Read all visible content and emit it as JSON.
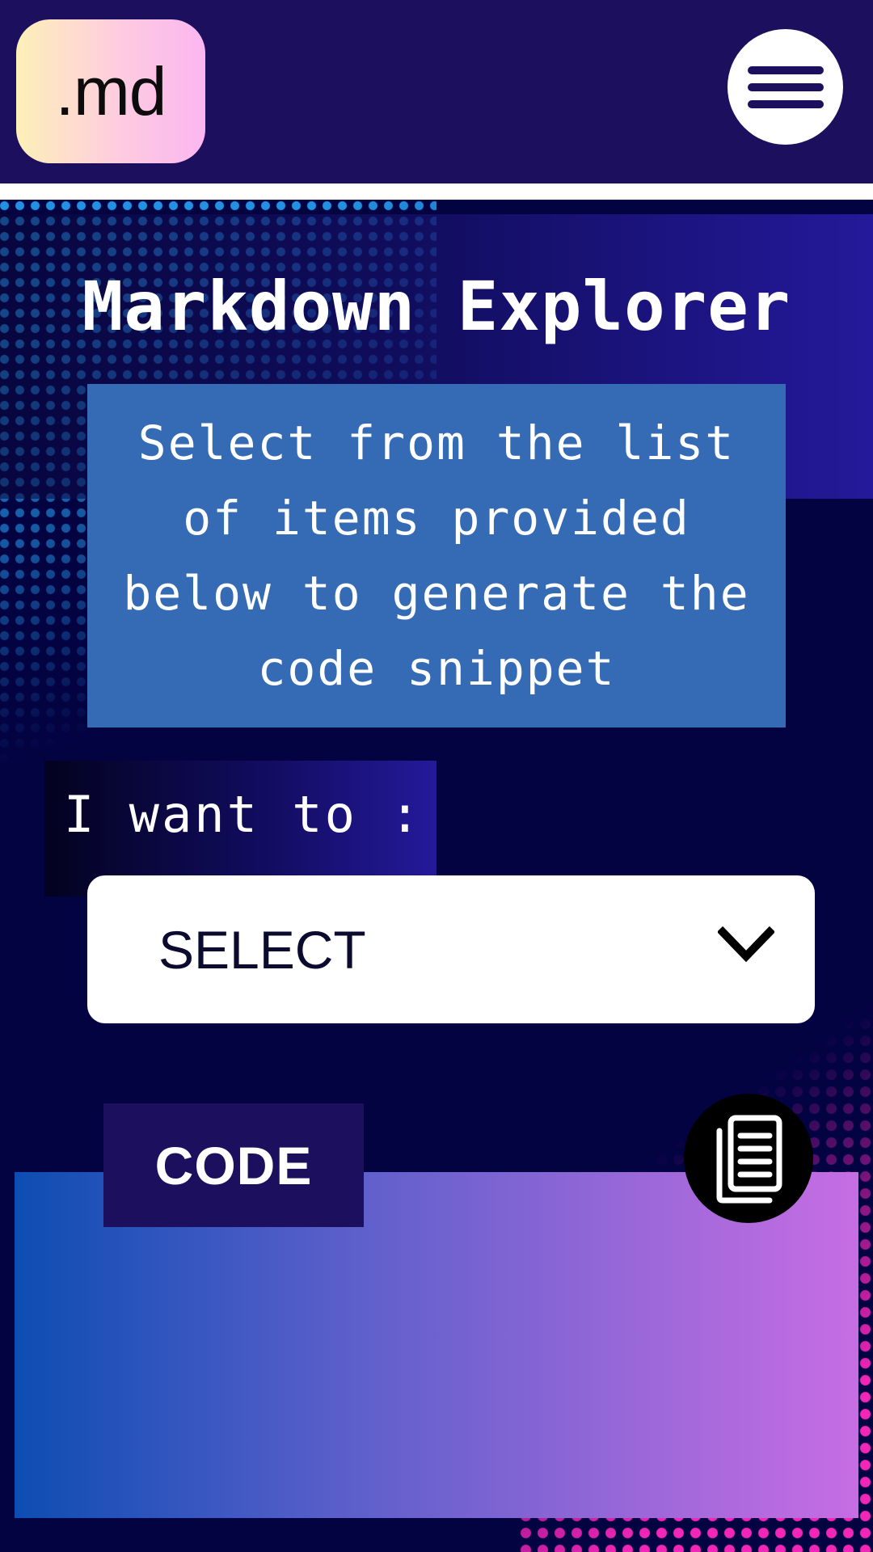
{
  "header": {
    "logo_text": ".md",
    "menu_icon": "hamburger-menu-icon"
  },
  "main": {
    "title": "Markdown Explorer",
    "intro_text": "Select from the list of items provided below to generate the code snippet",
    "want_label": "I want to :",
    "select": {
      "value": "SELECT",
      "icon": "chevron-down-icon"
    },
    "code": {
      "tab_label": "CODE",
      "copy_icon": "copy-document-icon",
      "content": ""
    }
  },
  "colors": {
    "header_bg": "#1c105e",
    "intro_bg": "#356bb5",
    "accent_blue_dots": "#28aaff",
    "accent_pink_dots": "#ff28be",
    "code_gradient_start": "#0d4db3",
    "code_gradient_end": "#c76de3"
  }
}
